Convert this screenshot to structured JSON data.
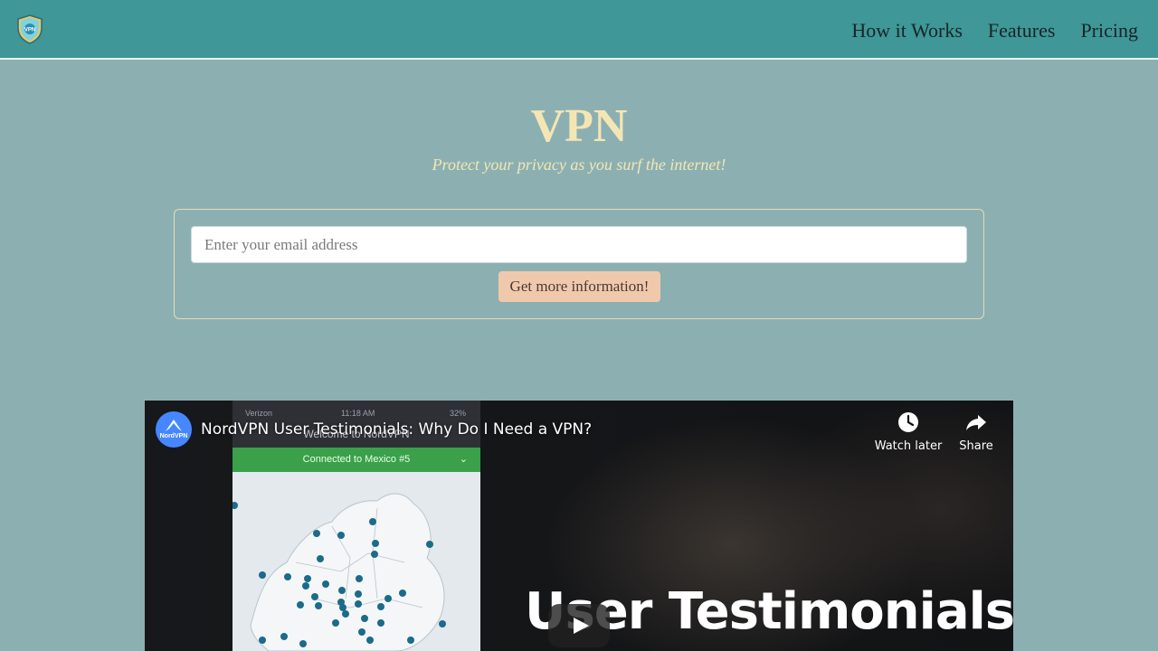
{
  "header": {
    "logo_text": "VPN",
    "nav": [
      {
        "label": "How it Works"
      },
      {
        "label": "Features"
      },
      {
        "label": "Pricing"
      }
    ]
  },
  "hero": {
    "title": "VPN",
    "subtitle": "Protect your privacy as you surf the internet!"
  },
  "form": {
    "email_placeholder": "Enter your email address",
    "email_value": "",
    "submit_label": "Get more information!"
  },
  "video": {
    "channel_name": "NordVPN",
    "title": "NordVPN User Testimonials: Why Do I Need a VPN?",
    "watch_later_label": "Watch later",
    "share_label": "Share",
    "overlay_text": "User Testimonials",
    "phone": {
      "carrier": "Verizon",
      "time": "11:18 AM",
      "battery": "32%",
      "welcome": "Welcome to NordVPN",
      "connected": "Connected to Mexico #5"
    }
  },
  "colors": {
    "header_bg": "#3f9797",
    "page_bg": "#8cb0b2",
    "accent_text": "#f4e6b4",
    "cta_bg": "#f0c9ad",
    "vpn_green": "#3aa04a"
  }
}
